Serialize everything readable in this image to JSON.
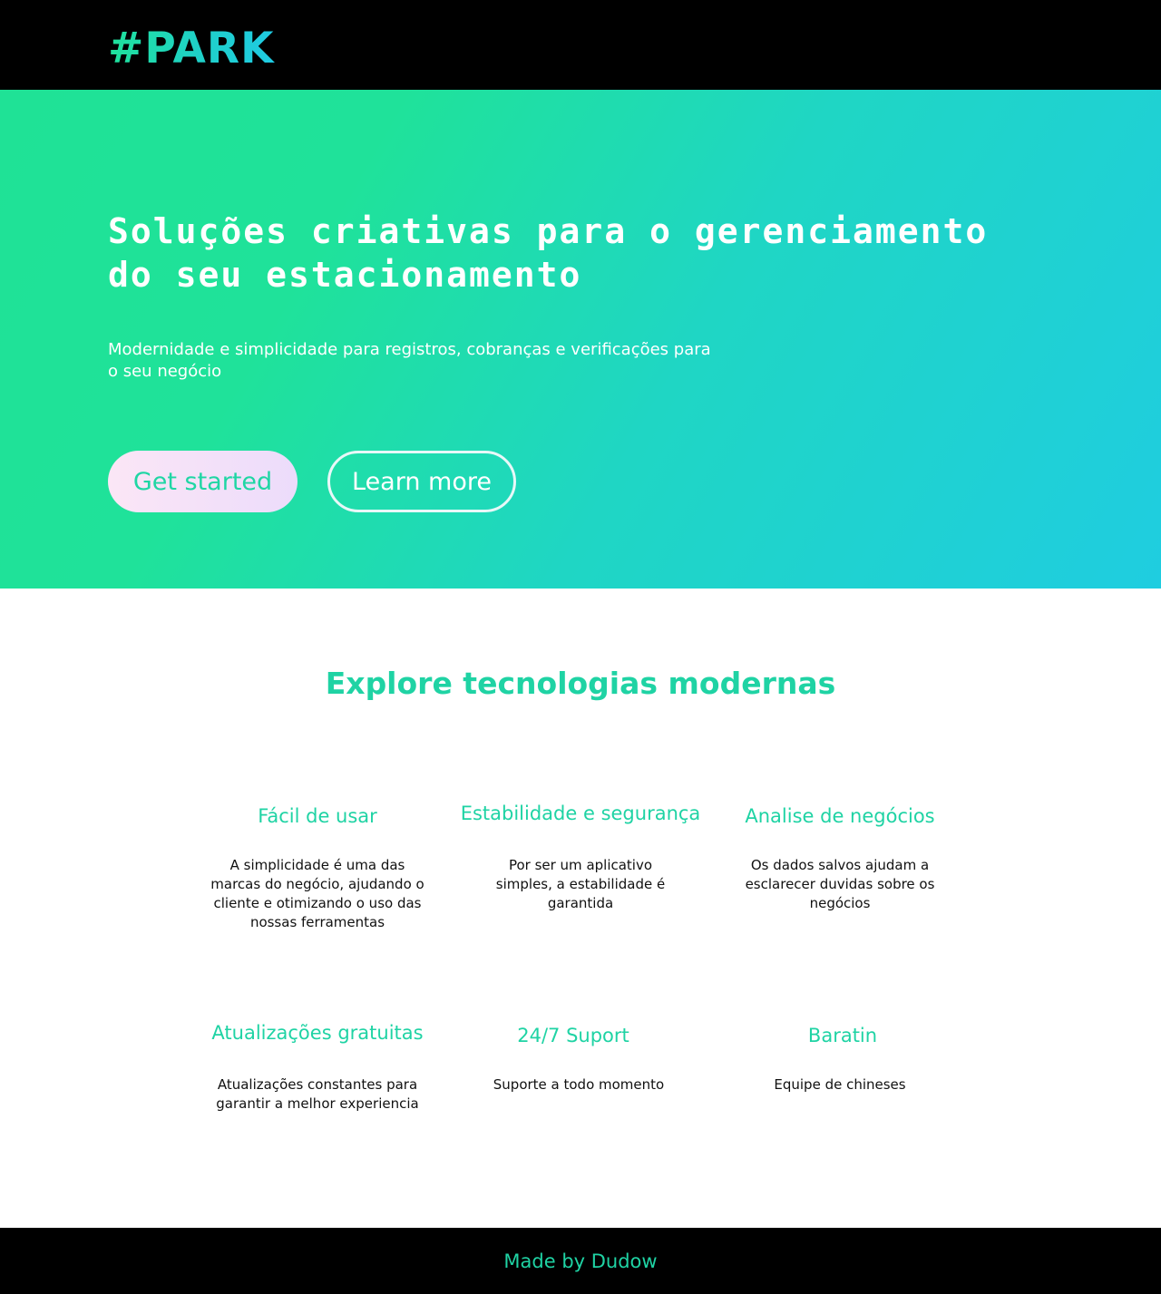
{
  "header": {
    "logo": "#PARK"
  },
  "hero": {
    "title": "Soluções criativas para o gerenciamento do seu estacionamento",
    "subtitle": "Modernidade e simplicidade para registros, cobranças e verificações para o seu negócio",
    "primary_button": "Get started",
    "secondary_button": "Learn more"
  },
  "features": {
    "heading": "Explore tecnologias modernas",
    "items": [
      {
        "title": "Fácil de usar",
        "description": "A simplicidade é uma das marcas do negócio, ajudando o cliente e otimizando o uso das nossas ferramentas"
      },
      {
        "title": "Estabilidade e segurança",
        "description": "Por ser um aplicativo simples, a estabilidade é garantida"
      },
      {
        "title": "Analise de negócios",
        "description": "Os dados salvos ajudam a esclarecer duvidas sobre os negócios"
      },
      {
        "title": "Atualizações gratuitas",
        "description": "Atualizações constantes para garantir a melhor experiencia"
      },
      {
        "title": "24/7 Suport",
        "description": "Suporte a todo momento"
      },
      {
        "title": "Baratin",
        "description": "Equipe de chineses"
      }
    ]
  },
  "footer": {
    "text": "Made by Dudow"
  },
  "colors": {
    "accent": "#1fd3a4",
    "hero_gradient_start": "#1fe296",
    "hero_gradient_end": "#1fcde0",
    "header_bg": "#000000"
  }
}
